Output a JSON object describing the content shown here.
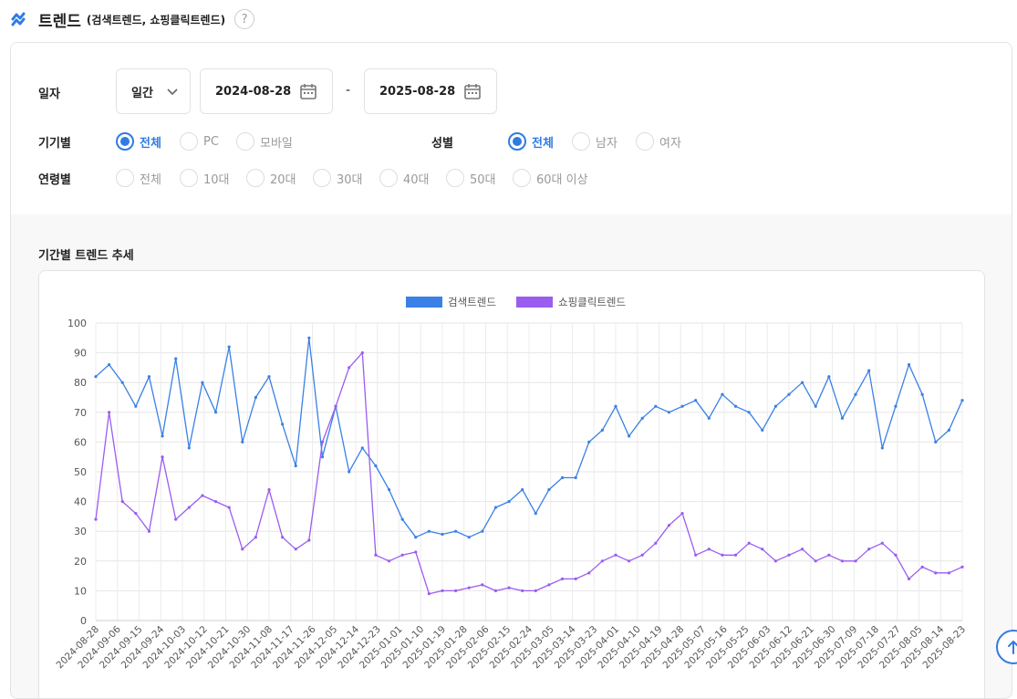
{
  "header": {
    "title": "트렌드",
    "subtitle": "(검색트렌드, 쇼핑클릭트렌드)",
    "help": "?"
  },
  "filters": {
    "date_label": "일자",
    "period_value": "일간",
    "start_date": "2024-08-28",
    "separator": "-",
    "end_date": "2025-08-28",
    "device_label": "기기별",
    "device_options": [
      "전체",
      "PC",
      "모바일"
    ],
    "device_selected": "전체",
    "gender_label": "성별",
    "gender_options": [
      "전체",
      "남자",
      "여자"
    ],
    "gender_selected": "전체",
    "age_label": "연령별",
    "age_options": [
      "전체",
      "10대",
      "20대",
      "30대",
      "40대",
      "50대",
      "60대 이상"
    ],
    "age_selected": ""
  },
  "section_title": "기간별 트렌드 추세",
  "colors": {
    "accent": "#2f7be3",
    "search": "#3a80e6",
    "shopping": "#9b5cf0"
  },
  "chart_data": {
    "type": "line",
    "title": "",
    "xlabel": "",
    "ylabel": "",
    "ylim": [
      0,
      100
    ],
    "yticks": [
      0,
      10,
      20,
      30,
      40,
      50,
      60,
      70,
      80,
      90,
      100
    ],
    "legend_position": "top-center",
    "grid": true,
    "x": [
      "2024-08-28",
      "2024-09-06",
      "2024-09-15",
      "2024-09-24",
      "2024-10-03",
      "2024-10-12",
      "2024-10-21",
      "2024-10-30",
      "2024-11-08",
      "2024-11-17",
      "2024-11-26",
      "2024-12-05",
      "2024-12-14",
      "2024-12-23",
      "2025-01-01",
      "2025-01-10",
      "2025-01-19",
      "2025-01-28",
      "2025-02-06",
      "2025-02-15",
      "2025-02-24",
      "2025-03-05",
      "2025-03-14",
      "2025-03-23",
      "2025-04-01",
      "2025-04-10",
      "2025-04-19",
      "2025-04-28",
      "2025-05-07",
      "2025-05-16",
      "2025-05-25",
      "2025-06-03",
      "2025-06-12",
      "2025-06-21",
      "2025-06-30",
      "2025-07-09",
      "2025-07-18",
      "2025-07-27",
      "2025-08-05",
      "2025-08-14",
      "2025-08-23"
    ],
    "series": [
      {
        "name": "검색트렌드",
        "color": "#3a80e6",
        "values": [
          82,
          86,
          80,
          72,
          82,
          62,
          88,
          58,
          80,
          70,
          92,
          60,
          75,
          82,
          66,
          52,
          95,
          55,
          72,
          50,
          58,
          52,
          44,
          34,
          28,
          30,
          29,
          30,
          28,
          30,
          38,
          40,
          44,
          36,
          44,
          48,
          48,
          60,
          64,
          72,
          62,
          68,
          72,
          70,
          72,
          74,
          68,
          76,
          72,
          70,
          64,
          72,
          76,
          80,
          72,
          82,
          68,
          76,
          84,
          58,
          72,
          86,
          76,
          60,
          64,
          74
        ]
      },
      {
        "name": "쇼핑클릭트렌드",
        "color": "#9b5cf0",
        "values": [
          34,
          70,
          40,
          36,
          30,
          55,
          34,
          38,
          42,
          40,
          38,
          24,
          28,
          44,
          28,
          24,
          27,
          60,
          72,
          85,
          90,
          22,
          20,
          22,
          23,
          9,
          10,
          10,
          11,
          12,
          10,
          11,
          10,
          10,
          12,
          14,
          14,
          16,
          20,
          22,
          20,
          22,
          26,
          32,
          36,
          22,
          24,
          22,
          22,
          26,
          24,
          20,
          22,
          24,
          20,
          22,
          20,
          20,
          24,
          26,
          22,
          14,
          18,
          16,
          16,
          18
        ]
      }
    ]
  }
}
